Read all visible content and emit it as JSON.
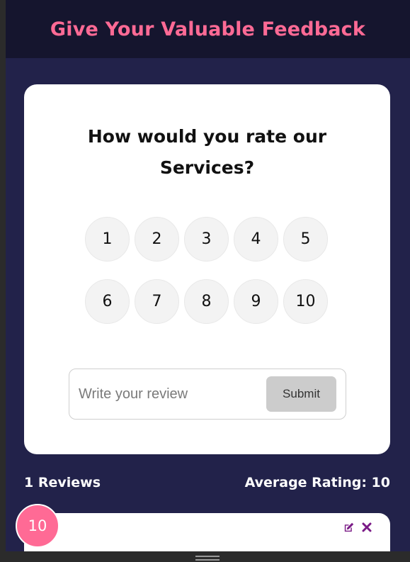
{
  "header": {
    "title": "Give Your Valuable Feedback"
  },
  "feedback_card": {
    "question": "How would you rate our Services?",
    "ratings_row1": [
      "1",
      "2",
      "3",
      "4",
      "5"
    ],
    "ratings_row2": [
      "6",
      "7",
      "8",
      "9",
      "10"
    ],
    "review_placeholder": "Write your review",
    "review_value": "",
    "submit_label": "Submit"
  },
  "stats": {
    "review_count": "1 Reviews",
    "average_rating": "Average Rating: 10"
  },
  "review_list": [
    {
      "rating": "10",
      "text": "",
      "edit_icon": "edit-icon",
      "delete_icon": "close-icon"
    }
  ],
  "colors": {
    "accent": "#ff6a95",
    "background": "#22224a",
    "header_bg": "#15152e",
    "action_icon": "#7a1a86"
  }
}
